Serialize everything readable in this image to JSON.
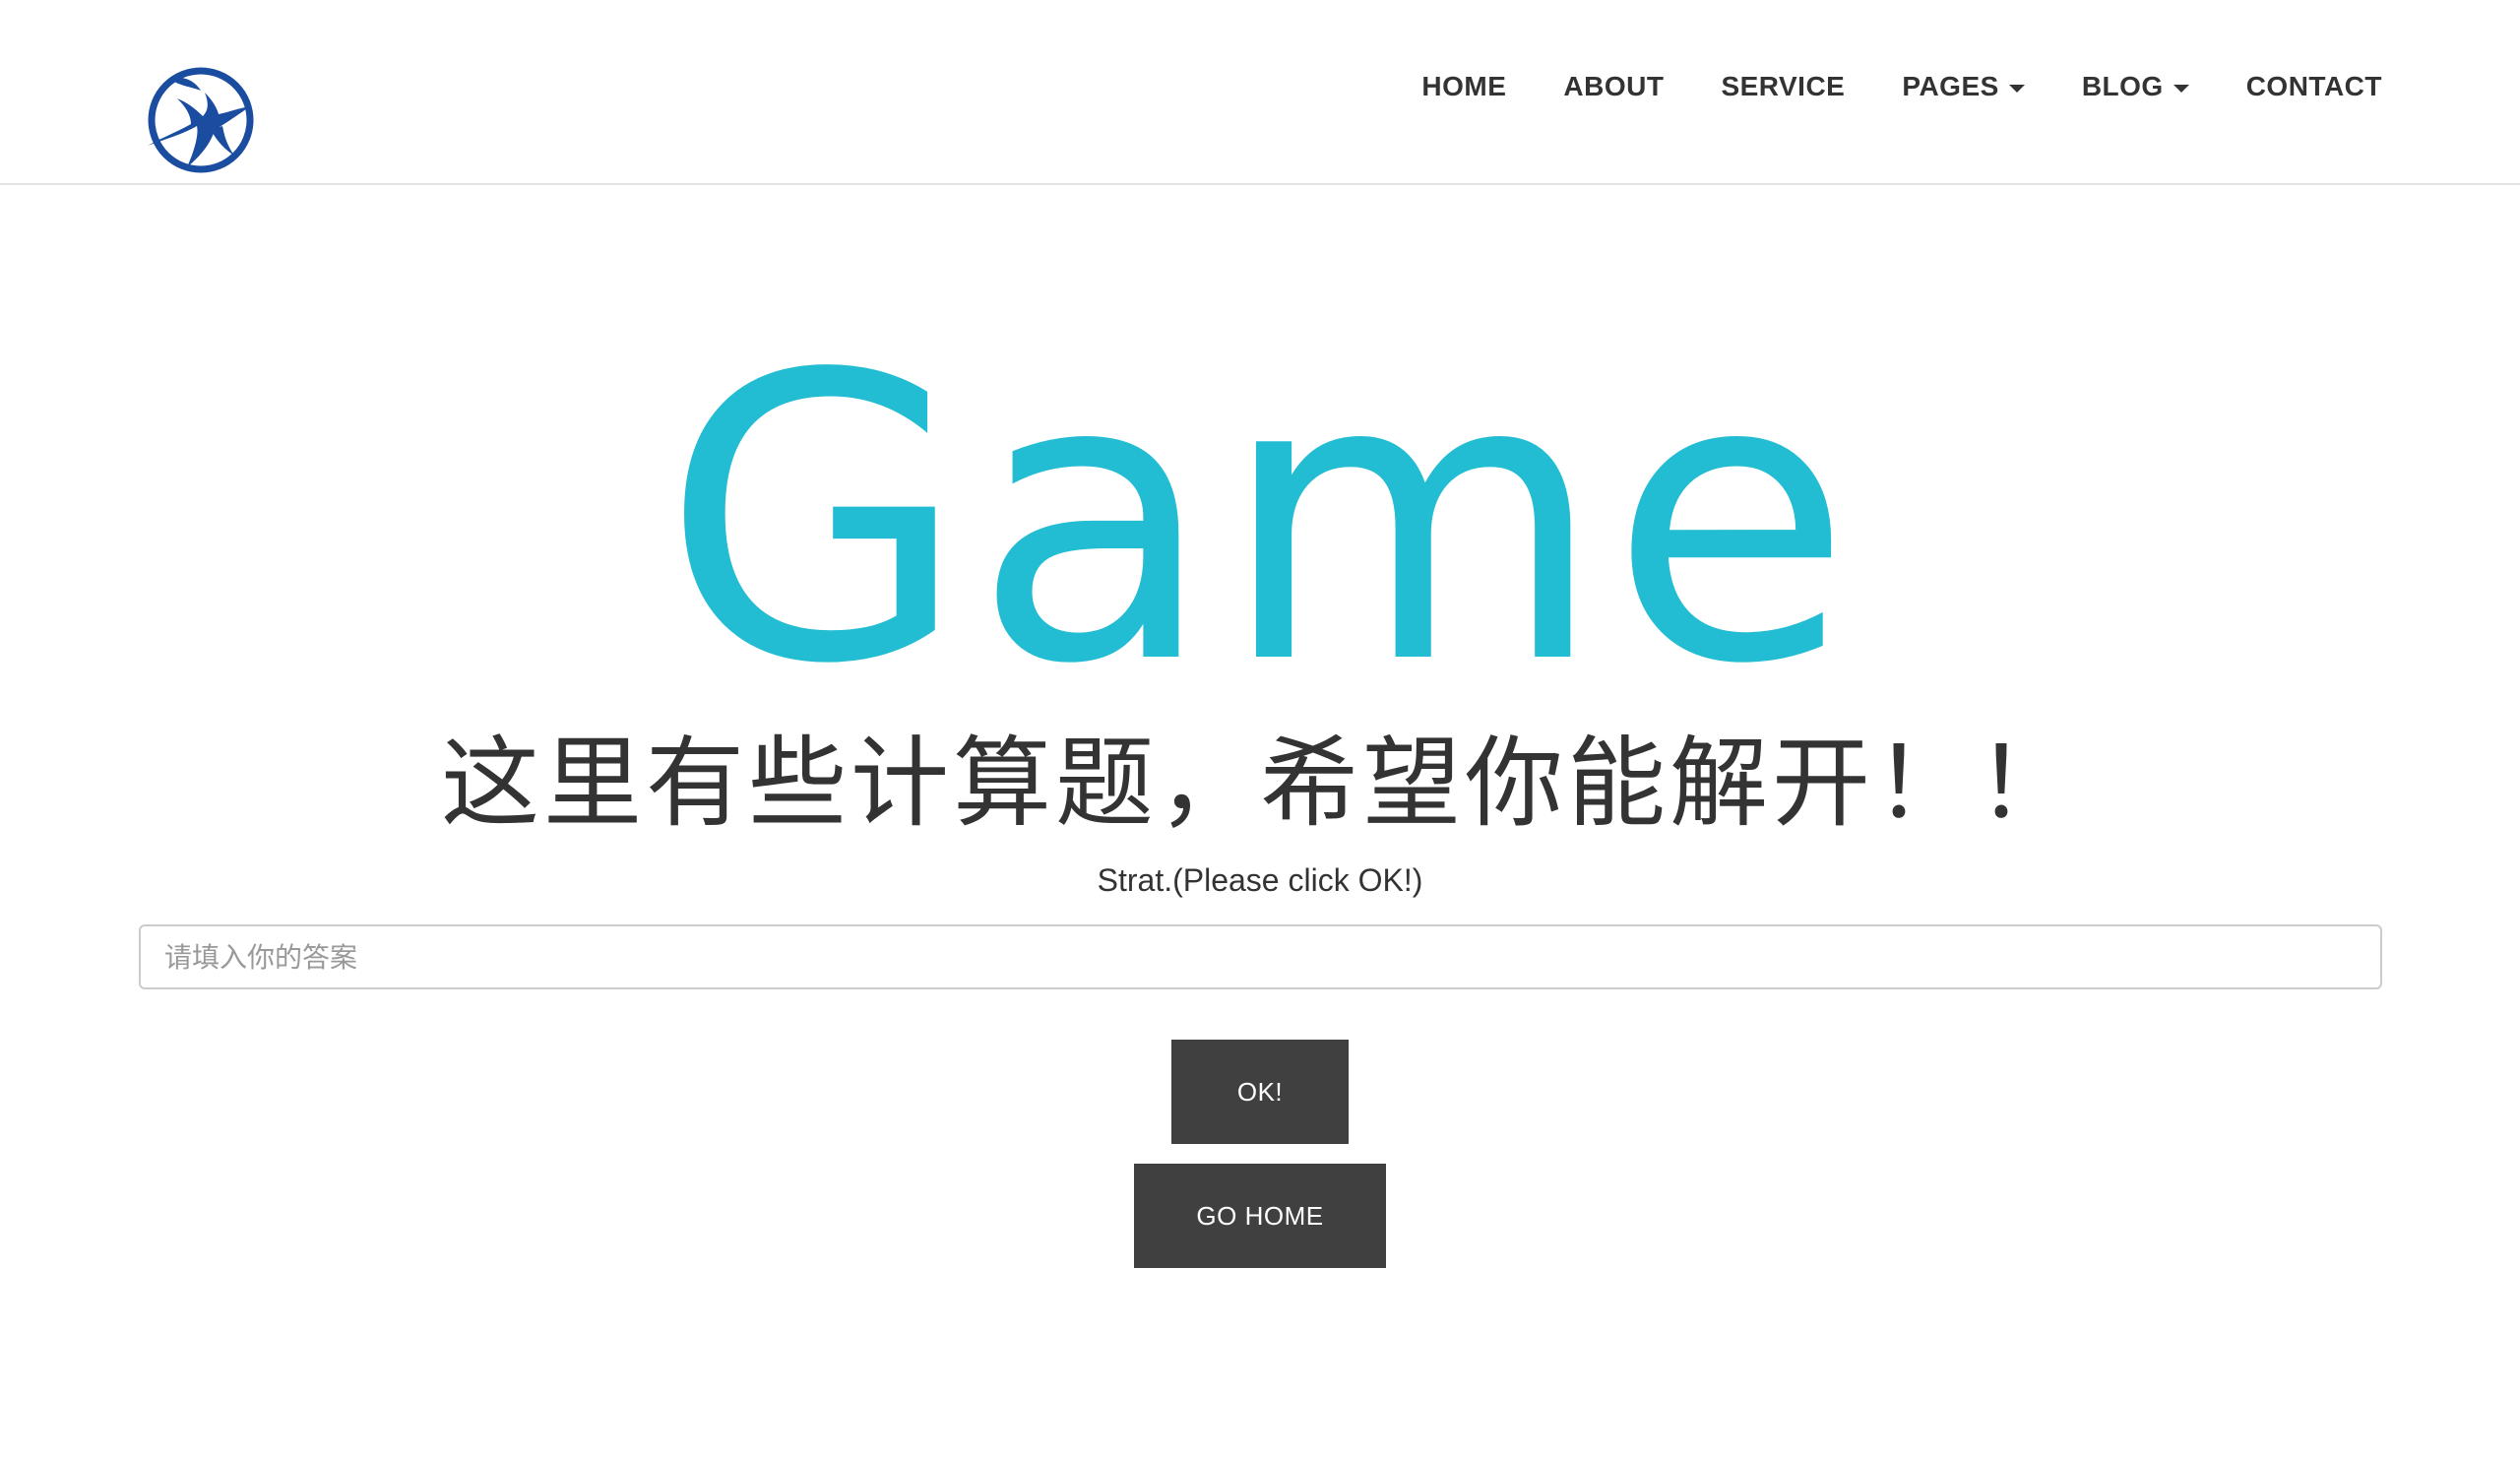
{
  "navbar": {
    "logo_icon": "bird-logo-icon",
    "brand_color": "#1a4da0",
    "items": [
      {
        "label": "HOME",
        "dropdown": false
      },
      {
        "label": "ABOUT",
        "dropdown": false
      },
      {
        "label": "SERVICE",
        "dropdown": false
      },
      {
        "label": "PAGES",
        "dropdown": true
      },
      {
        "label": "BLOG",
        "dropdown": true
      },
      {
        "label": "CONTACT",
        "dropdown": false
      }
    ]
  },
  "hero": {
    "title": "Game",
    "title_color": "#22bcd3",
    "subtitle": "这里有些计算题，希望你能解开！！",
    "status": "Strat.(Please click OK!)"
  },
  "form": {
    "answer_placeholder": "请填入你的答案",
    "answer_value": "",
    "ok_label": "OK!",
    "home_label": "GO HOME",
    "button_color": "#404040"
  }
}
